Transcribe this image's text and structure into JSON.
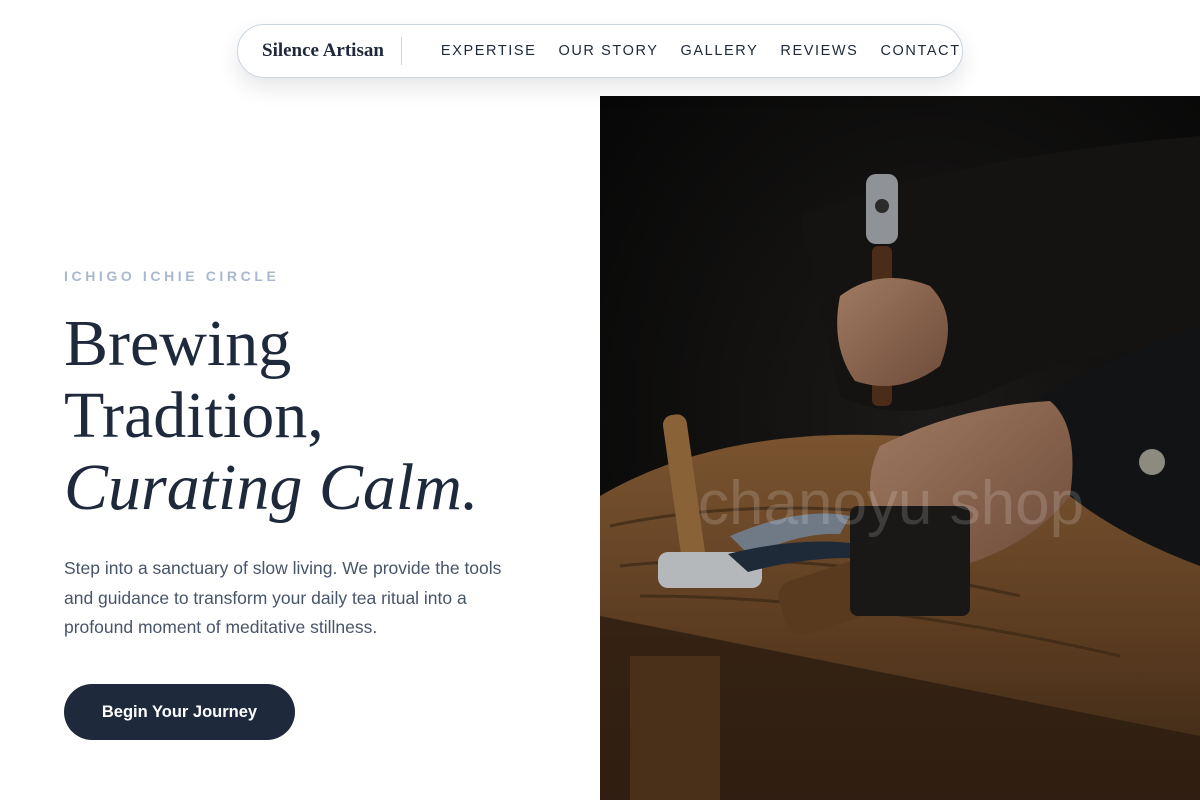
{
  "nav": {
    "brand": "Silence Artisan",
    "links": [
      "EXPERTISE",
      "OUR STORY",
      "GALLERY",
      "REVIEWS",
      "CONTACT"
    ]
  },
  "hero": {
    "eyebrow": "ICHIGO ICHIE CIRCLE",
    "headline_line1": "Brewing",
    "headline_line2": "Tradition,",
    "headline_line3": "Curating Calm.",
    "description": "Step into a sanctuary of slow living. We provide the tools and guidance to transform your daily tea ritual into a profound moment of meditative stillness.",
    "cta_label": "Begin Your Journey"
  },
  "image": {
    "subject": "artisan-hands-working-with-tools-on-wooden-bench",
    "watermark": "chanoyu shop"
  },
  "colors": {
    "primary": "#1e293b",
    "muted_text": "#475569",
    "eyebrow": "#a8b8cf",
    "border": "#cbd5e1"
  }
}
